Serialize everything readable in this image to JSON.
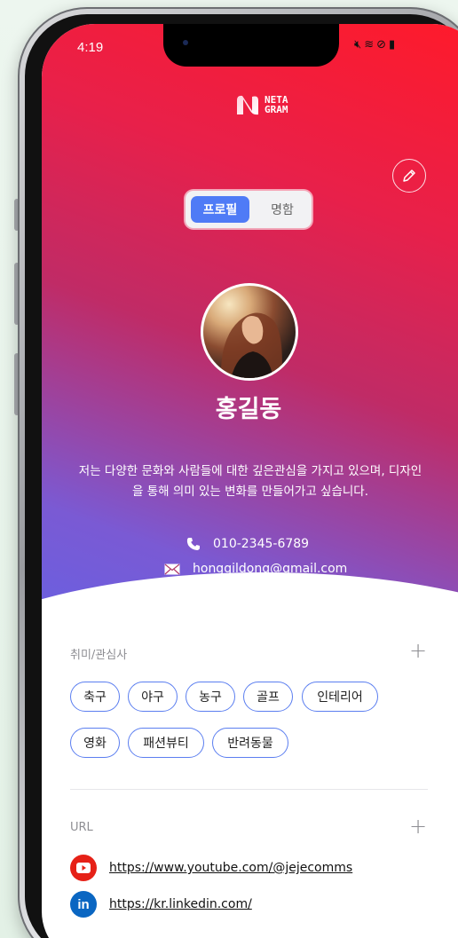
{
  "status_bar": {
    "time": "4:19"
  },
  "logo": {
    "line1": "NETA",
    "line2": "GRAM"
  },
  "toggle": {
    "active": "프로필",
    "inactive": "명함"
  },
  "profile": {
    "name": "홍길동",
    "bio": "저는 다양한 문화와 사람들에 대한 깊은관심을 가지고 있으며, 디자인을 통해 의미 있는 변화를 만들어가고 싶습니다.",
    "phone": "010-2345-6789",
    "email": "honggildong@gmail.com"
  },
  "hobbies": {
    "title": "취미/관심사",
    "add_label": "+",
    "items": [
      "축구",
      "야구",
      "농구",
      "골프",
      "인테리어",
      "영화",
      "패션뷰티",
      "반려동물"
    ]
  },
  "urls": {
    "title": "URL",
    "add_label": "+",
    "items": [
      {
        "icon": "youtube-icon",
        "text": "https://www.youtube.com/@jejecomms"
      },
      {
        "icon": "linkedin-icon",
        "text": "https://kr.linkedin.com/"
      }
    ]
  },
  "colors": {
    "accent": "#4f7bf6",
    "chip_border": "#5b7ef0",
    "gradient_top": "#ff1a2a",
    "gradient_bottom": "#6a5fe0",
    "youtube": "#e62117",
    "linkedin": "#0a66c2"
  }
}
